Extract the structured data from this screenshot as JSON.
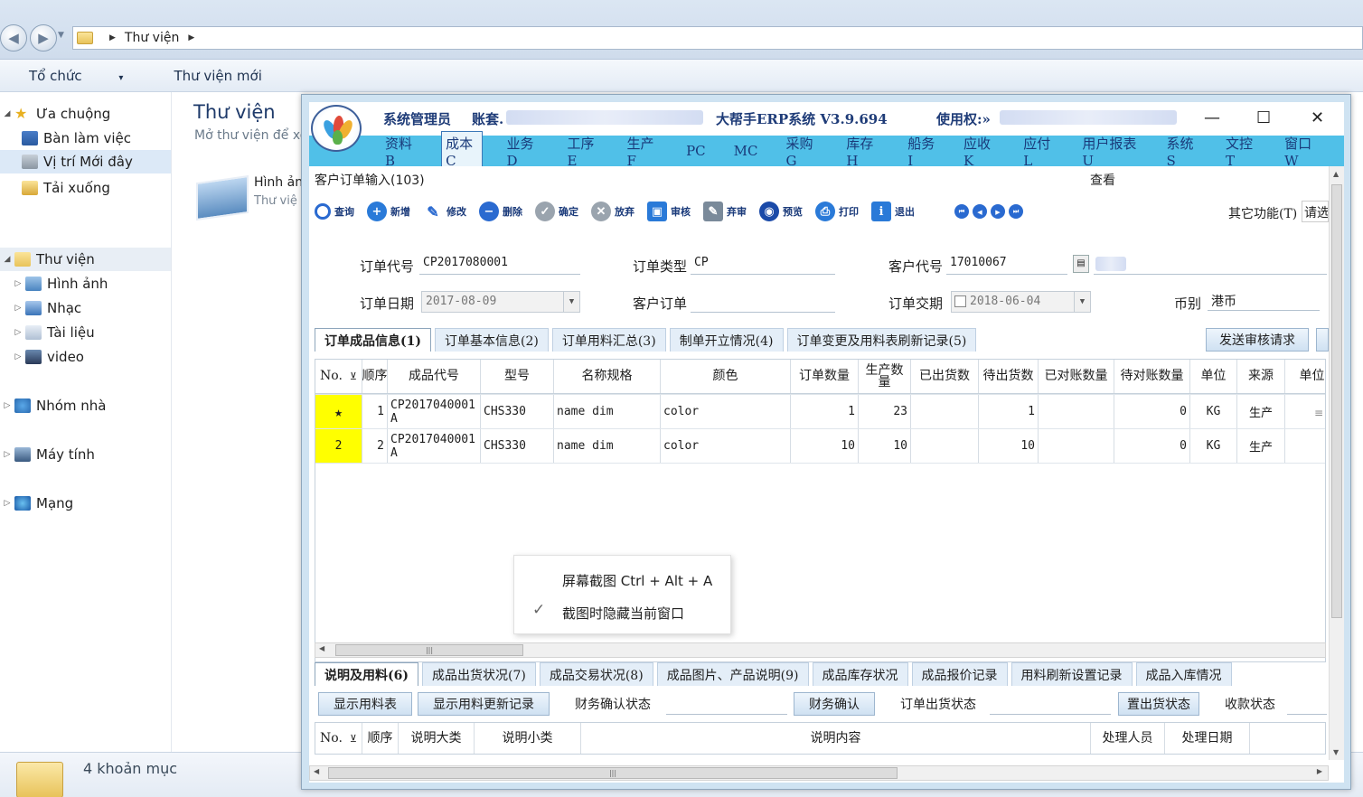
{
  "explorer": {
    "address": {
      "crumb": "Thư viện"
    },
    "commands": [
      "Tổ chức",
      "Thư viện mới"
    ],
    "organize_caret": "▾",
    "nav": {
      "favorites": "Ưa chuộng",
      "desktop": "Bàn làm việc",
      "recent": "Vị trí Mới đây",
      "downloads": "Tải xuống",
      "libraries": "Thư viện",
      "pictures": "Hình ảnh",
      "music": "Nhạc",
      "documents": "Tài liệu",
      "video": "video",
      "homegroup": "Nhóm nhà",
      "computer": "Máy tính",
      "network": "Mạng"
    },
    "main": {
      "title": "Thư viện",
      "subtitle": "Mở thư viện để xe",
      "item_name": "Hình ản",
      "item_sub": "Thư việ"
    },
    "status": "4 khoản mục"
  },
  "erp": {
    "titlebar": {
      "user": "系统管理员",
      "account_label": "账套.",
      "system": "大帮手ERP系统 V3.9.694",
      "license": "使用权:»"
    },
    "window_controls": {
      "minimize": "—",
      "maximize": "☐",
      "close": "✕"
    },
    "menu": [
      "资料B",
      "成本C",
      "业务D",
      "工序E",
      "生产F",
      "PC",
      "MC",
      "采购G",
      "库存H",
      "船务I",
      "应收K",
      "应付L",
      "用户报表U",
      "系统S",
      "文控T",
      "窗口W"
    ],
    "form_title": "客户订单输入(103)",
    "view_label": "查看",
    "toolbar": [
      "查询",
      "新增",
      "修改",
      "删除",
      "确定",
      "放弃",
      "审核",
      "弃审",
      "预览",
      "打印",
      "退出"
    ],
    "nav_buttons": [
      "⏮",
      "◀",
      "▶",
      "⏭"
    ],
    "other_functions": "其它功能(T)",
    "other_trunc": "请选",
    "fields": {
      "order_no_label": "订单代号",
      "order_no": "CP2017080001",
      "order_type_label": "订单类型",
      "order_type": "CP",
      "customer_code_label": "客户代号",
      "customer_code": "17010067",
      "order_date_label": "订单日期",
      "order_date": "2017-08-09",
      "customer_order_label": "客户订单",
      "customer_order": "",
      "delivery_label": "订单交期",
      "delivery_date": "2018-06-04",
      "currency_label": "币别",
      "currency": "港币"
    },
    "tabs_top": [
      "订单成品信息(1)",
      "订单基本信息(2)",
      "订单用料汇总(3)",
      "制单开立情况(4)",
      "订单变更及用料表刷新记录(5)"
    ],
    "send_review": "发送审核请求",
    "grid": {
      "headers": [
        "No.",
        "顺序",
        "成品代号",
        "型号",
        "名称规格",
        "颜色",
        "订单数量",
        "生产数量",
        "已出货数",
        "待出货数",
        "已对账数量",
        "待对账数量",
        "单位",
        "来源",
        "单位"
      ],
      "filter_icon": "⊻",
      "rows": [
        {
          "no": "★",
          "seq": "1",
          "code": "CP2017040001",
          "code2": "A",
          "model": "CHS330",
          "name": "name dim",
          "color": "color",
          "qty": "1",
          "prod": "23",
          "shipped": "",
          "pending": "1",
          "checked": "",
          "to_check": "0",
          "unit": "KG",
          "source": "生产"
        },
        {
          "no": "2",
          "seq": "2",
          "code": "CP2017040001",
          "code2": "A",
          "model": "CHS330",
          "name": "name dim",
          "color": "color",
          "qty": "10",
          "prod": "10",
          "shipped": "",
          "pending": "10",
          "checked": "",
          "to_check": "0",
          "unit": "KG",
          "source": "生产"
        }
      ]
    },
    "tabs_bottom": [
      "说明及用料(6)",
      "成品出货状况(7)",
      "成品交易状况(8)",
      "成品图片、产品说明(9)",
      "成品库存状况",
      "成品报价记录",
      "用料刷新设置记录",
      "成品入库情况"
    ],
    "bottom_controls": {
      "show_bom": "显示用料表",
      "show_bom_updates": "显示用料更新记录",
      "finance_status_label": "财务确认状态",
      "finance_confirm": "财务确认",
      "ship_status_label": "订单出货状态",
      "set_ship_status": "置出货状态",
      "payment_status_label": "收款状态"
    },
    "bottom_grid": {
      "headers": [
        "No.",
        "顺序",
        "说明大类",
        "说明小类",
        "说明内容",
        "处理人员",
        "处理日期"
      ]
    }
  },
  "context_menu": {
    "items": [
      {
        "label": "屏幕截图 Ctrl + Alt + A",
        "checked": false
      },
      {
        "label": "截图时隐藏当前窗口",
        "checked": true
      }
    ]
  }
}
